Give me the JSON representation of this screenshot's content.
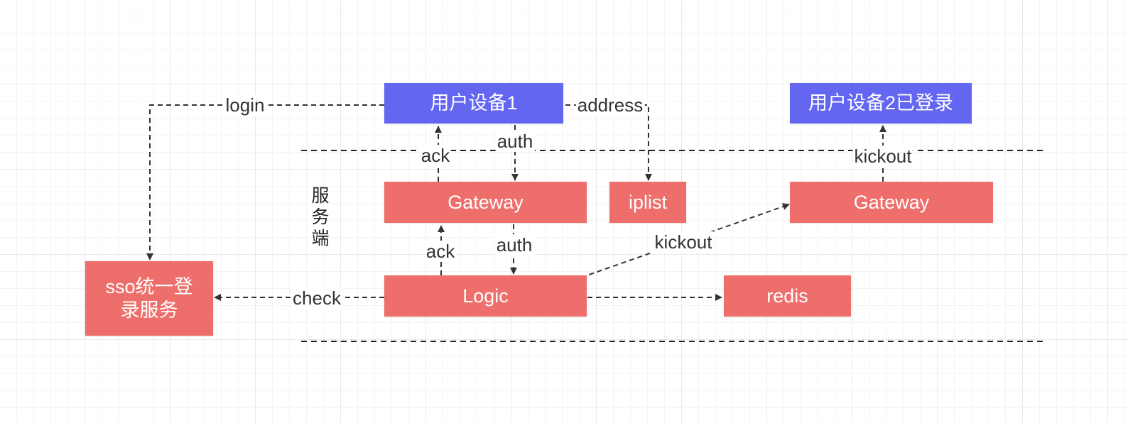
{
  "colors": {
    "device": "#6366f1",
    "service": "#ed6e6a",
    "line": "#333333",
    "text_on_node": "#ffffff"
  },
  "nodes": {
    "device1": "用户设备1",
    "device2": "用户设备2已登录",
    "gateway1": "Gateway",
    "gateway2": "Gateway",
    "iplist": "iplist",
    "logic": "Logic",
    "redis": "redis",
    "sso": "sso统一登录服务"
  },
  "edge_labels": {
    "login": "login",
    "address": "address",
    "auth_top": "auth",
    "ack_top": "ack",
    "auth_bottom": "auth",
    "ack_bottom": "ack",
    "kickout_logic": "kickout",
    "kickout_device2": "kickout",
    "check": "check"
  },
  "zone_label": "服务端"
}
